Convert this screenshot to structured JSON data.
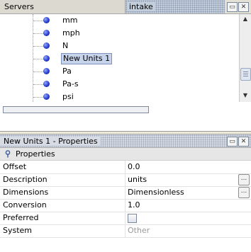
{
  "top_tabs": {
    "servers_label": "Servers",
    "intake_label": "intake"
  },
  "tree": {
    "items": [
      {
        "label": "mm"
      },
      {
        "label": "mph"
      },
      {
        "label": "N"
      },
      {
        "label": "New Units 1",
        "selected": true
      },
      {
        "label": "Pa"
      },
      {
        "label": "Pa-s"
      },
      {
        "label": "psi"
      }
    ]
  },
  "properties_panel": {
    "title": "New Units 1 - Properties",
    "section_label": "Properties",
    "rows": [
      {
        "name": "Offset",
        "value": "0.0"
      },
      {
        "name": "Description",
        "value": "units"
      },
      {
        "name": "Dimensions",
        "value": "Dimensionless"
      },
      {
        "name": "Conversion",
        "value": "1.0"
      },
      {
        "name": "Preferred",
        "value": ""
      },
      {
        "name": "System",
        "value": "Other"
      }
    ]
  },
  "icons": {
    "restore": "restore-icon",
    "close": "close-icon",
    "bullet": "unit-bullet-icon",
    "pin": "pin-icon",
    "ellipsis": "ellipsis-icon"
  },
  "colors": {
    "bullet": "#2a3fd0",
    "selection": "#c6d3ea",
    "muted_text": "#9a9a9a"
  }
}
